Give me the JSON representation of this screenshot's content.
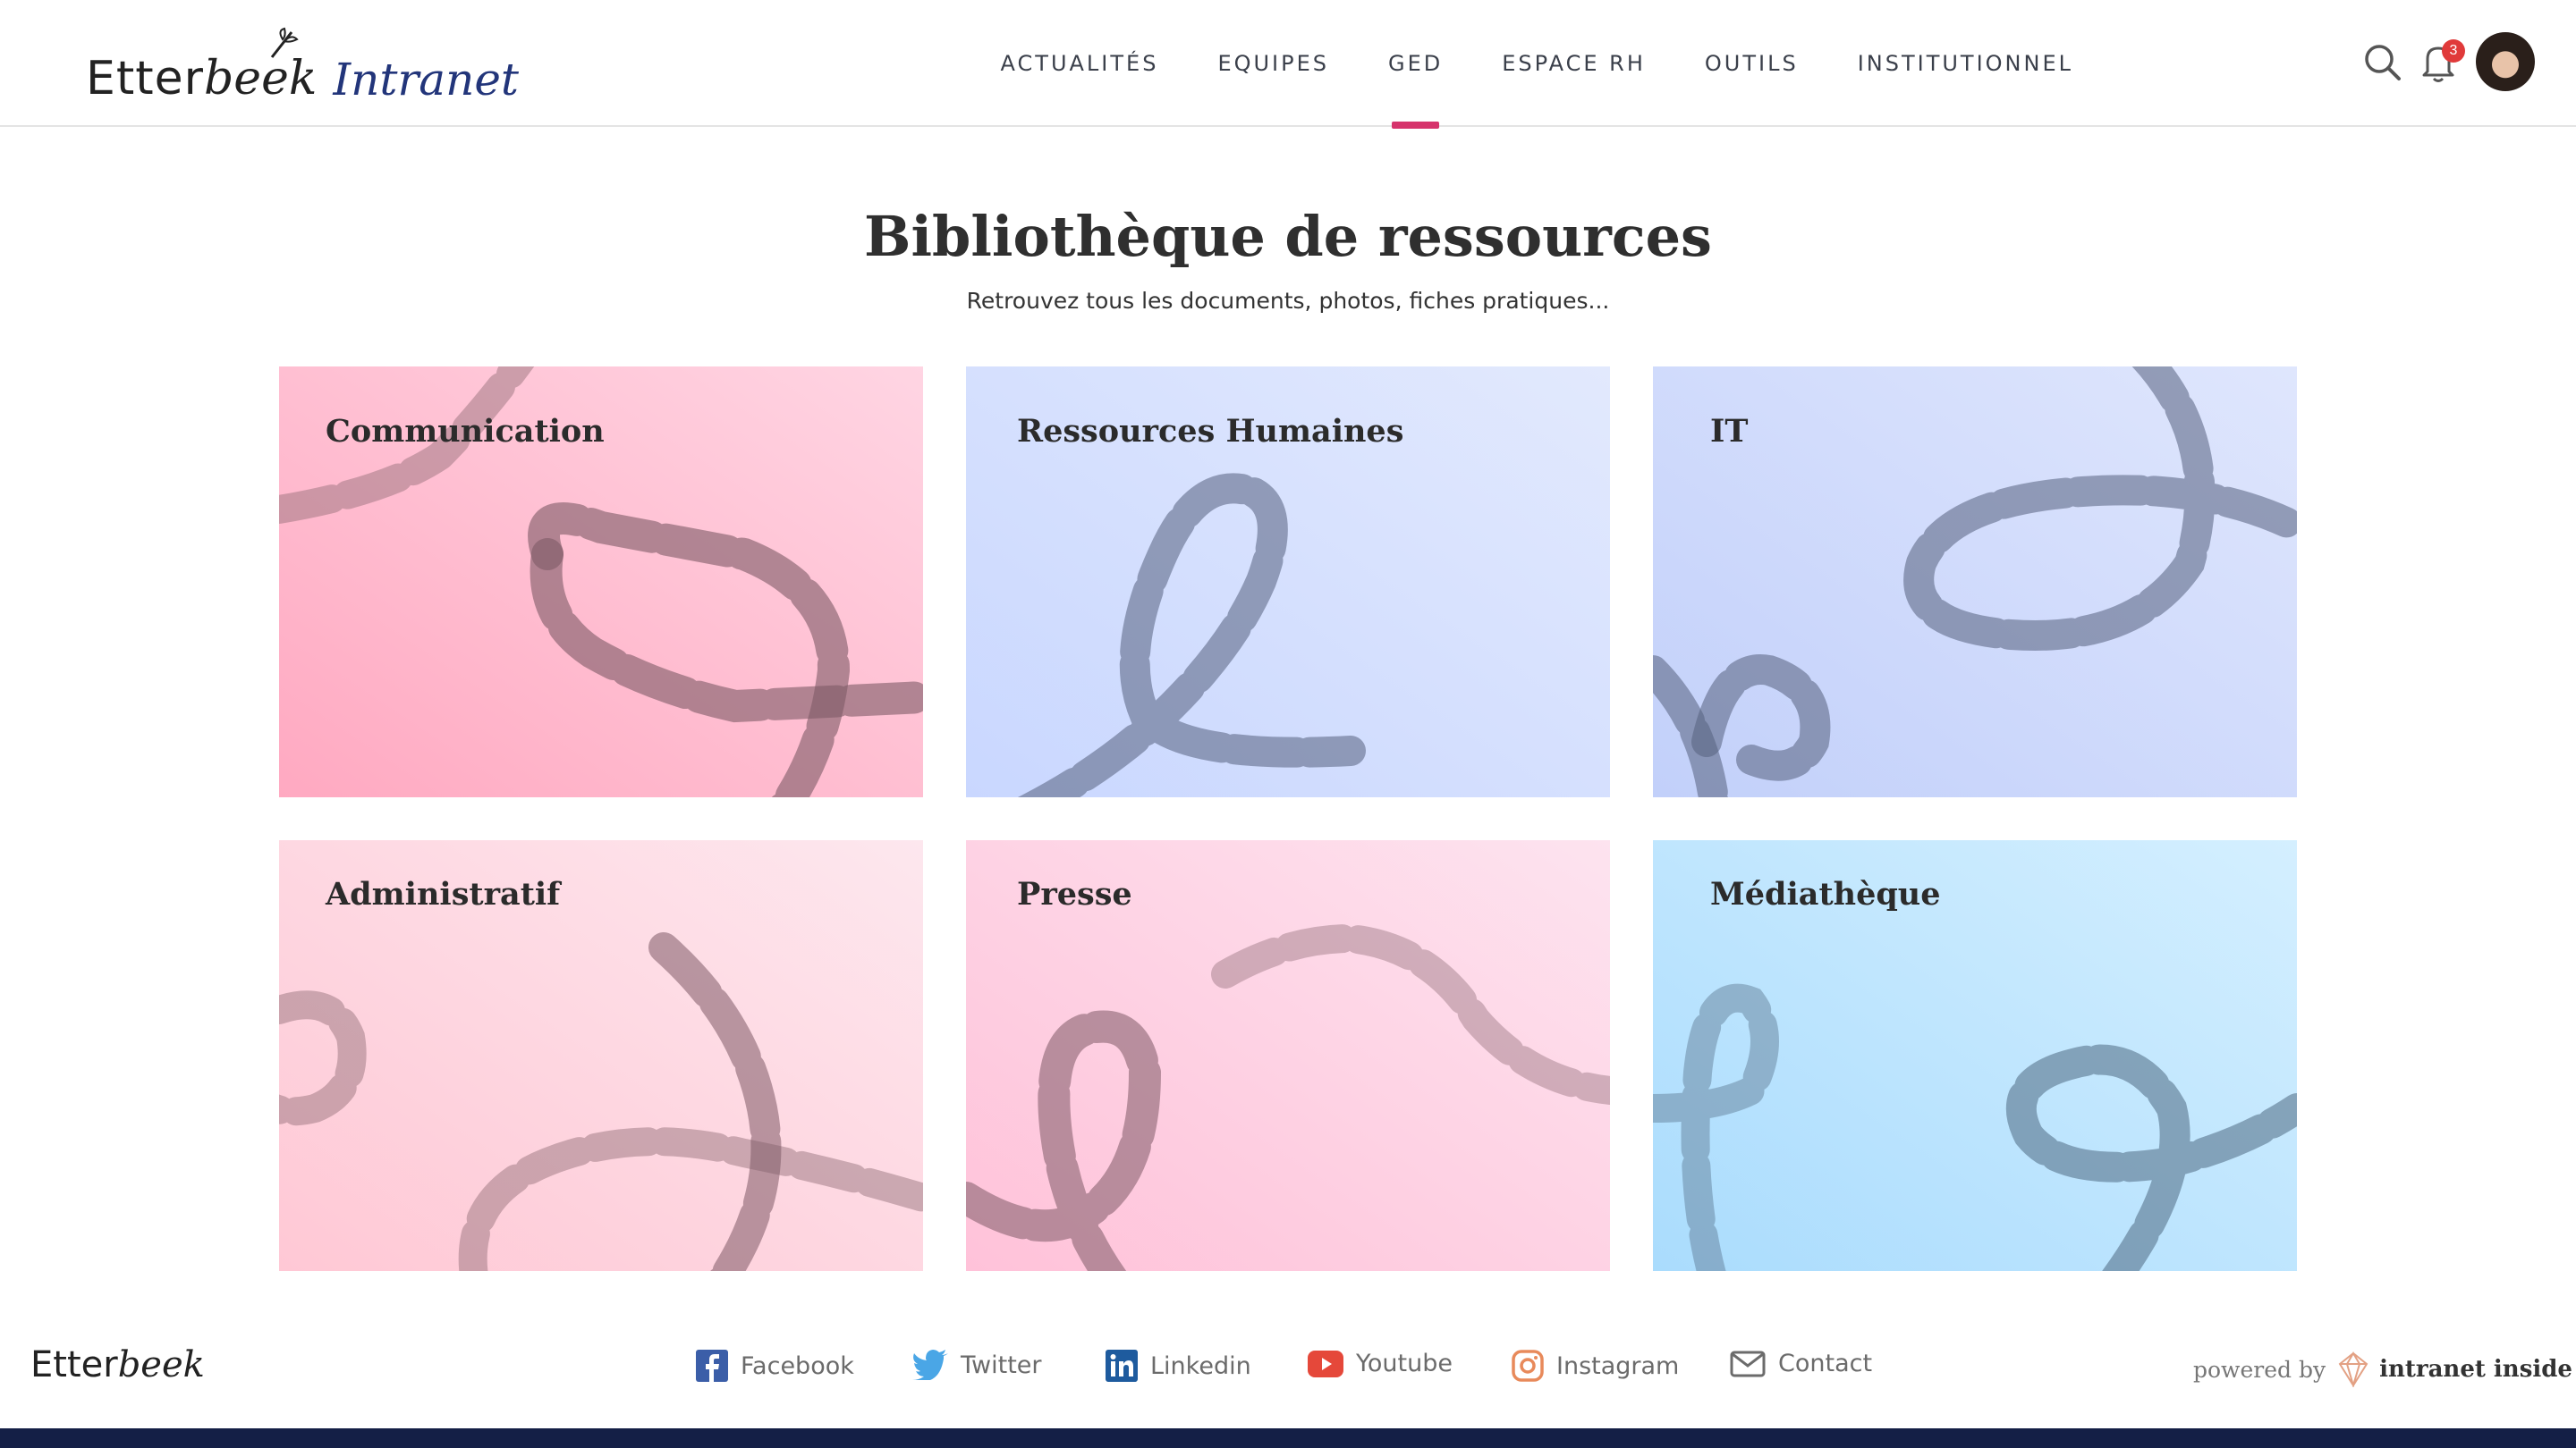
{
  "header": {
    "logo": {
      "part1": "Etter",
      "part2": "beek",
      "part3": "Intranet"
    },
    "nav": [
      {
        "label": "ACTUALITÉS",
        "active": false
      },
      {
        "label": "EQUIPES",
        "active": false
      },
      {
        "label": "GED",
        "active": true
      },
      {
        "label": "ESPACE RH",
        "active": false
      },
      {
        "label": "OUTILS",
        "active": false
      },
      {
        "label": "INSTITUTIONNEL",
        "active": false
      }
    ],
    "search_icon": "search-icon",
    "notifications": {
      "icon": "bell-icon",
      "count": "3"
    },
    "avatar_icon": "user-avatar",
    "accent_color": "#d6336c"
  },
  "main": {
    "title": "Bibliothèque de ressources",
    "subtitle": "Retrouvez tous les documents, photos, fiches pratiques..."
  },
  "cards": [
    {
      "label": "Communication",
      "color_start": "#ffa9c1",
      "color_end": "#ffd5e3"
    },
    {
      "label": "Ressources Humaines",
      "color_start": "#c9d7ff",
      "color_end": "#e2e9fd"
    },
    {
      "label": "IT",
      "color_start": "#c2d0fa",
      "color_end": "#dfe6fd"
    },
    {
      "label": "Administratif",
      "color_start": "#ffc8d5",
      "color_end": "#fde7ee"
    },
    {
      "label": "Presse",
      "color_start": "#ffc2d9",
      "color_end": "#fde3ef"
    },
    {
      "label": "Médiathèque",
      "color_start": "#aadcfd",
      "color_end": "#d4efff"
    }
  ],
  "footer": {
    "logo": {
      "part1": "Etter",
      "part2": "beek"
    },
    "social": [
      {
        "label": "Facebook",
        "icon": "facebook-icon",
        "color": "#3b5ea8"
      },
      {
        "label": "Twitter",
        "icon": "twitter-icon",
        "color": "#4aa6e6"
      },
      {
        "label": "Linkedin",
        "icon": "linkedin-icon",
        "color": "#1e5b9e"
      },
      {
        "label": "Youtube",
        "icon": "youtube-icon",
        "color": "#e5483a"
      },
      {
        "label": "Instagram",
        "icon": "instagram-icon",
        "color": "#e88a5b"
      },
      {
        "label": "Contact",
        "icon": "mail-icon",
        "color": "#6b6b6b"
      }
    ],
    "powered_by": "powered by",
    "brand": "intranet inside",
    "bottom_bar_color": "#141f46"
  }
}
